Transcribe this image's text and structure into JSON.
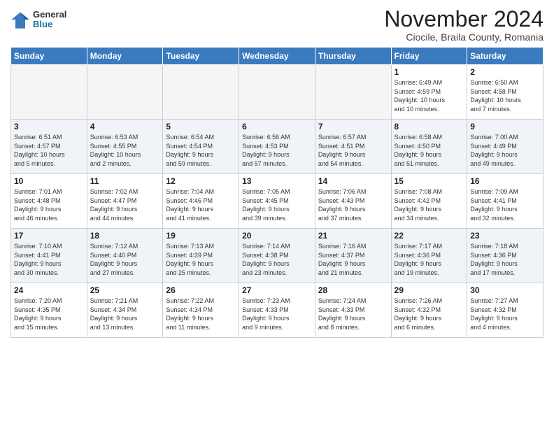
{
  "header": {
    "logo": {
      "general": "General",
      "blue": "Blue"
    },
    "title": "November 2024",
    "subtitle": "Ciocile, Braila County, Romania"
  },
  "calendar": {
    "weekdays": [
      "Sunday",
      "Monday",
      "Tuesday",
      "Wednesday",
      "Thursday",
      "Friday",
      "Saturday"
    ],
    "weeks": [
      [
        {
          "day": "",
          "info": ""
        },
        {
          "day": "",
          "info": ""
        },
        {
          "day": "",
          "info": ""
        },
        {
          "day": "",
          "info": ""
        },
        {
          "day": "",
          "info": ""
        },
        {
          "day": "1",
          "info": "Sunrise: 6:49 AM\nSunset: 4:59 PM\nDaylight: 10 hours\nand 10 minutes."
        },
        {
          "day": "2",
          "info": "Sunrise: 6:50 AM\nSunset: 4:58 PM\nDaylight: 10 hours\nand 7 minutes."
        }
      ],
      [
        {
          "day": "3",
          "info": "Sunrise: 6:51 AM\nSunset: 4:57 PM\nDaylight: 10 hours\nand 5 minutes."
        },
        {
          "day": "4",
          "info": "Sunrise: 6:53 AM\nSunset: 4:55 PM\nDaylight: 10 hours\nand 2 minutes."
        },
        {
          "day": "5",
          "info": "Sunrise: 6:54 AM\nSunset: 4:54 PM\nDaylight: 9 hours\nand 59 minutes."
        },
        {
          "day": "6",
          "info": "Sunrise: 6:56 AM\nSunset: 4:53 PM\nDaylight: 9 hours\nand 57 minutes."
        },
        {
          "day": "7",
          "info": "Sunrise: 6:57 AM\nSunset: 4:51 PM\nDaylight: 9 hours\nand 54 minutes."
        },
        {
          "day": "8",
          "info": "Sunrise: 6:58 AM\nSunset: 4:50 PM\nDaylight: 9 hours\nand 51 minutes."
        },
        {
          "day": "9",
          "info": "Sunrise: 7:00 AM\nSunset: 4:49 PM\nDaylight: 9 hours\nand 49 minutes."
        }
      ],
      [
        {
          "day": "10",
          "info": "Sunrise: 7:01 AM\nSunset: 4:48 PM\nDaylight: 9 hours\nand 46 minutes."
        },
        {
          "day": "11",
          "info": "Sunrise: 7:02 AM\nSunset: 4:47 PM\nDaylight: 9 hours\nand 44 minutes."
        },
        {
          "day": "12",
          "info": "Sunrise: 7:04 AM\nSunset: 4:46 PM\nDaylight: 9 hours\nand 41 minutes."
        },
        {
          "day": "13",
          "info": "Sunrise: 7:05 AM\nSunset: 4:45 PM\nDaylight: 9 hours\nand 39 minutes."
        },
        {
          "day": "14",
          "info": "Sunrise: 7:06 AM\nSunset: 4:43 PM\nDaylight: 9 hours\nand 37 minutes."
        },
        {
          "day": "15",
          "info": "Sunrise: 7:08 AM\nSunset: 4:42 PM\nDaylight: 9 hours\nand 34 minutes."
        },
        {
          "day": "16",
          "info": "Sunrise: 7:09 AM\nSunset: 4:41 PM\nDaylight: 9 hours\nand 32 minutes."
        }
      ],
      [
        {
          "day": "17",
          "info": "Sunrise: 7:10 AM\nSunset: 4:41 PM\nDaylight: 9 hours\nand 30 minutes."
        },
        {
          "day": "18",
          "info": "Sunrise: 7:12 AM\nSunset: 4:40 PM\nDaylight: 9 hours\nand 27 minutes."
        },
        {
          "day": "19",
          "info": "Sunrise: 7:13 AM\nSunset: 4:39 PM\nDaylight: 9 hours\nand 25 minutes."
        },
        {
          "day": "20",
          "info": "Sunrise: 7:14 AM\nSunset: 4:38 PM\nDaylight: 9 hours\nand 23 minutes."
        },
        {
          "day": "21",
          "info": "Sunrise: 7:16 AM\nSunset: 4:37 PM\nDaylight: 9 hours\nand 21 minutes."
        },
        {
          "day": "22",
          "info": "Sunrise: 7:17 AM\nSunset: 4:36 PM\nDaylight: 9 hours\nand 19 minutes."
        },
        {
          "day": "23",
          "info": "Sunrise: 7:18 AM\nSunset: 4:36 PM\nDaylight: 9 hours\nand 17 minutes."
        }
      ],
      [
        {
          "day": "24",
          "info": "Sunrise: 7:20 AM\nSunset: 4:35 PM\nDaylight: 9 hours\nand 15 minutes."
        },
        {
          "day": "25",
          "info": "Sunrise: 7:21 AM\nSunset: 4:34 PM\nDaylight: 9 hours\nand 13 minutes."
        },
        {
          "day": "26",
          "info": "Sunrise: 7:22 AM\nSunset: 4:34 PM\nDaylight: 9 hours\nand 11 minutes."
        },
        {
          "day": "27",
          "info": "Sunrise: 7:23 AM\nSunset: 4:33 PM\nDaylight: 9 hours\nand 9 minutes."
        },
        {
          "day": "28",
          "info": "Sunrise: 7:24 AM\nSunset: 4:33 PM\nDaylight: 9 hours\nand 8 minutes."
        },
        {
          "day": "29",
          "info": "Sunrise: 7:26 AM\nSunset: 4:32 PM\nDaylight: 9 hours\nand 6 minutes."
        },
        {
          "day": "30",
          "info": "Sunrise: 7:27 AM\nSunset: 4:32 PM\nDaylight: 9 hours\nand 4 minutes."
        }
      ]
    ]
  }
}
